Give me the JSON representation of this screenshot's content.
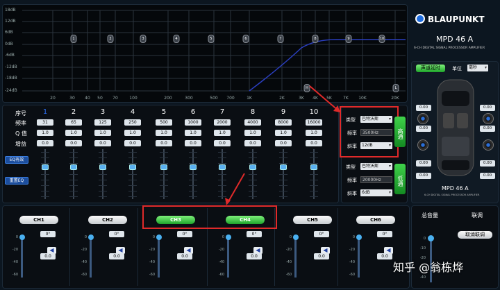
{
  "brand": {
    "logo": "BLAUPUNKT",
    "model": "MPD 46 A",
    "subtitle": "6-CH DIGITAL SIGNAL PROCESSOR AMPLIFIER"
  },
  "graph": {
    "y_labels": [
      "18dB",
      "12dB",
      "6dB",
      "0dB",
      "-6dB",
      "-12dB",
      "-18dB",
      "-24dB"
    ],
    "x_labels": [
      "20",
      "30",
      "40",
      "50",
      "70",
      "100",
      "200",
      "300",
      "500",
      "700",
      "1K",
      "2K",
      "3K",
      "4K",
      "5K",
      "7K",
      "10K",
      "20K"
    ],
    "band_points": [
      "1",
      "2",
      "3",
      "4",
      "5",
      "6",
      "7",
      "8",
      "9",
      "10"
    ],
    "hp_point": "H",
    "lp_point": "L"
  },
  "params": {
    "row_labels": {
      "index": "序号",
      "freq": "频率",
      "q": "Q 值",
      "gain": "增益"
    },
    "columns": [
      {
        "n": "1",
        "freq": "31",
        "q": "1.0",
        "gain": "0.0"
      },
      {
        "n": "2",
        "freq": "65",
        "q": "1.0",
        "gain": "0.0"
      },
      {
        "n": "3",
        "freq": "125",
        "q": "1.0",
        "gain": "0.0"
      },
      {
        "n": "4",
        "freq": "250",
        "q": "1.0",
        "gain": "0.0"
      },
      {
        "n": "5",
        "freq": "500",
        "q": "1.0",
        "gain": "0.0"
      },
      {
        "n": "6",
        "freq": "1000",
        "q": "1.0",
        "gain": "0.0"
      },
      {
        "n": "7",
        "freq": "2000",
        "q": "1.0",
        "gain": "0.0"
      },
      {
        "n": "8",
        "freq": "4000",
        "q": "1.0",
        "gain": "0.0"
      },
      {
        "n": "9",
        "freq": "8000",
        "q": "1.0",
        "gain": "0.0"
      },
      {
        "n": "10",
        "freq": "16000",
        "q": "1.0",
        "gain": "0.0"
      }
    ],
    "eq_enable": "EQ有效",
    "eq_reset": "重置EQ"
  },
  "highpass": {
    "type_label": "类型",
    "type_value": "巴特沃斯",
    "freq_label": "频率",
    "freq_value": "3500Hz",
    "slope_label": "斜率",
    "slope_value": "12dB",
    "button": "高通"
  },
  "lowpass": {
    "type_label": "类型",
    "type_value": "巴特沃斯",
    "freq_label": "频率",
    "freq_value": "20000Hz",
    "slope_label": "斜率",
    "slope_value": "6dB",
    "button": "低通"
  },
  "delay": {
    "tab_active": "声道延时",
    "unit_label": "单位",
    "unit_value": "毫秒",
    "values": [
      "0.00",
      "0.00",
      "0.00",
      "0.00",
      "0.00",
      "0.00",
      "0.00",
      "0.00"
    ],
    "model_caption": "MPD 46 A",
    "model_sub": "6-CH DIGITAL SIGNAL PROCESSOR AMPLIFIER"
  },
  "channels": [
    {
      "name": "CH1",
      "phase": "0°",
      "volume": "0.0",
      "active": false
    },
    {
      "name": "CH2",
      "phase": "0°",
      "volume": "0.0",
      "active": false
    },
    {
      "name": "CH3",
      "phase": "0°",
      "volume": "0.0",
      "active": true
    },
    {
      "name": "CH4",
      "phase": "0°",
      "volume": "0.0",
      "active": true
    },
    {
      "name": "CH5",
      "phase": "0°",
      "volume": "0.0",
      "active": false
    },
    {
      "name": "CH6",
      "phase": "0°",
      "volume": "0.0",
      "active": false
    }
  ],
  "vol_scale": [
    "0",
    "-20",
    "-40",
    "-60"
  ],
  "master": {
    "title": "总音量",
    "link_title": "联调",
    "cancel_link": "取消联调",
    "scale": [
      "0",
      "-10",
      "-20",
      "-30",
      "-40"
    ],
    "value": "0.0"
  },
  "watermark": "知乎 @翁栋烨",
  "colors": {
    "accent_green": "#1ea42a",
    "accent_blue": "#2c6ef0",
    "highlight_red": "#e02a2a"
  }
}
